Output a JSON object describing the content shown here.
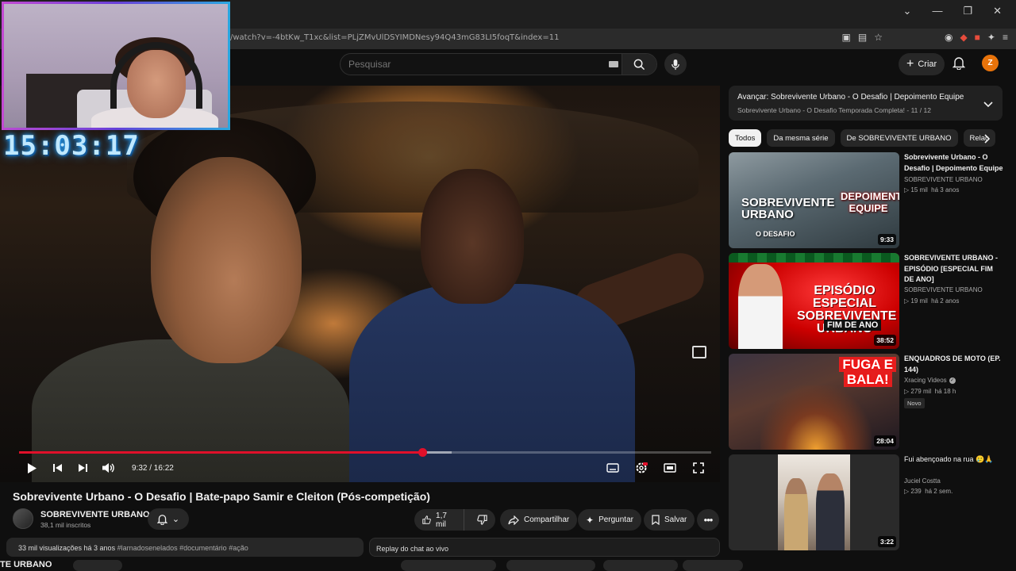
{
  "browser": {
    "url": "/watch?v=-4btKw_T1xc&list=PLjZMvUlDSYIMDNesy94Q43mG83LI5foqT&index=11"
  },
  "header": {
    "search_placeholder": "Pesquisar",
    "create_label": "Criar",
    "avatar_letter": "Z"
  },
  "stream_overlay": {
    "clock": "15:03:17"
  },
  "player": {
    "time": "9:32 / 16:22",
    "progress_fraction": 0.582,
    "buffer_fraction": 0.625
  },
  "video": {
    "title": "Sobrevivente Urbano - O Desafio | Bate-papo Samir e Cleiton (Pós-competição)",
    "channel_name": "SOBREVIVENTE URBANO",
    "subscribers": "38,1 mil inscritos",
    "likes": "1,7 mil",
    "share_label": "Compartilhar",
    "ask_label": "Perguntar",
    "save_label": "Salvar",
    "description_stats": "33 mil visualizações  há 3 anos",
    "description_tags": "#larnadosenelados #documentário #ação",
    "chat_replay": "Replay do chat ao vivo"
  },
  "bottom": {
    "channel_fragment": "TE URBANO"
  },
  "sidebar": {
    "next_title": "Avançar: Sobrevivente Urbano - O Desafio | Depoimento Equipe",
    "next_playlist": "Sobrevivente Urbano - O Desafio Temporada Completa! - 11 / 12",
    "chips": [
      "Todos",
      "Da mesma série",
      "De SOBREVIVENTE URBANO",
      "Relac"
    ],
    "recommendations": [
      {
        "title": "Sobrevivente Urbano - O Desafio | Depoimento Equipe",
        "channel": "SOBREVIVENTE URBANO",
        "views": "▷ 15 mil",
        "age": "há 3 anos",
        "duration": "9:33",
        "thumb_text": "SOBREVIVENTE URBANO",
        "thumb_sub": "O DESAFIO",
        "thumb_tag": "DEPOIMENTO EQUIPE"
      },
      {
        "title": "SOBREVIVENTE URBANO - EPISÓDIO [ESPECIAL FIM DE ANO]",
        "channel": "SOBREVIVENTE URBANO",
        "views": "▷ 19 mil",
        "age": "há 2 anos",
        "duration": "38:52",
        "thumb_text": "EPISÓDIO ESPECIAL SOBREVIVENTE URBANO",
        "thumb_tag": "FIM DE ANO"
      },
      {
        "title": "ENQUADROS DE MOTO (EP. 144)",
        "channel": "Xracing Videos",
        "views": "▷ 279 mil",
        "age": "há 18 h",
        "duration": "28:04",
        "badge": "Novo",
        "thumb_line1": "FUGA E",
        "thumb_line2": "BALA!"
      },
      {
        "title": "Fui abençoado na rua 🥲🙏",
        "channel": "Juciel Costta",
        "views": "▷ 239",
        "age": "há 2 sem.",
        "duration": "3:22"
      }
    ]
  },
  "colors": {
    "accent_red": "#e0102a",
    "background": "#0f0f0f",
    "avatar": "#e8730a"
  }
}
